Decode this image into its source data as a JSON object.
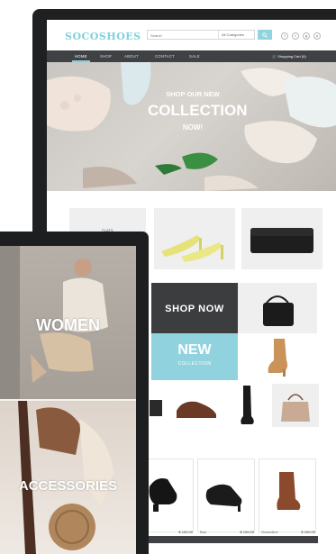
{
  "site": {
    "logo": "SOCOSHOES",
    "search": {
      "placeholder": "Search",
      "category": "All Categories"
    },
    "social_icons": [
      "f",
      "t",
      "g",
      "p"
    ]
  },
  "nav": {
    "items": [
      "HOME",
      "SHOP",
      "ABOUT",
      "CONTACT",
      "SALE"
    ],
    "active": "HOME",
    "cart_label": "Shopping Cart (0)"
  },
  "hero": {
    "line1": "SHOP OUR NEW",
    "line2": "COLLECTION",
    "line3": "NOW!"
  },
  "products": {
    "flats_label": "FLATS",
    "shop_now": "SHOP NOW",
    "new_label": "NEW",
    "collection_label": "COLLECTION"
  },
  "bottom_products": [
    {
      "name": "",
      "price": "$ 100.00"
    },
    {
      "name": "Boo",
      "price": "$ 100.00"
    },
    {
      "name": "Granodine",
      "price": "$ 100.00"
    }
  ],
  "tablet": {
    "women_label": "WOMEN",
    "accessories_label": "ACCESSORIES"
  },
  "colors": {
    "accent": "#7fd1dc",
    "nav_bg": "#3f4144",
    "new_tile": "#90d3de",
    "shop_now_tile": "#3c3d3f"
  }
}
